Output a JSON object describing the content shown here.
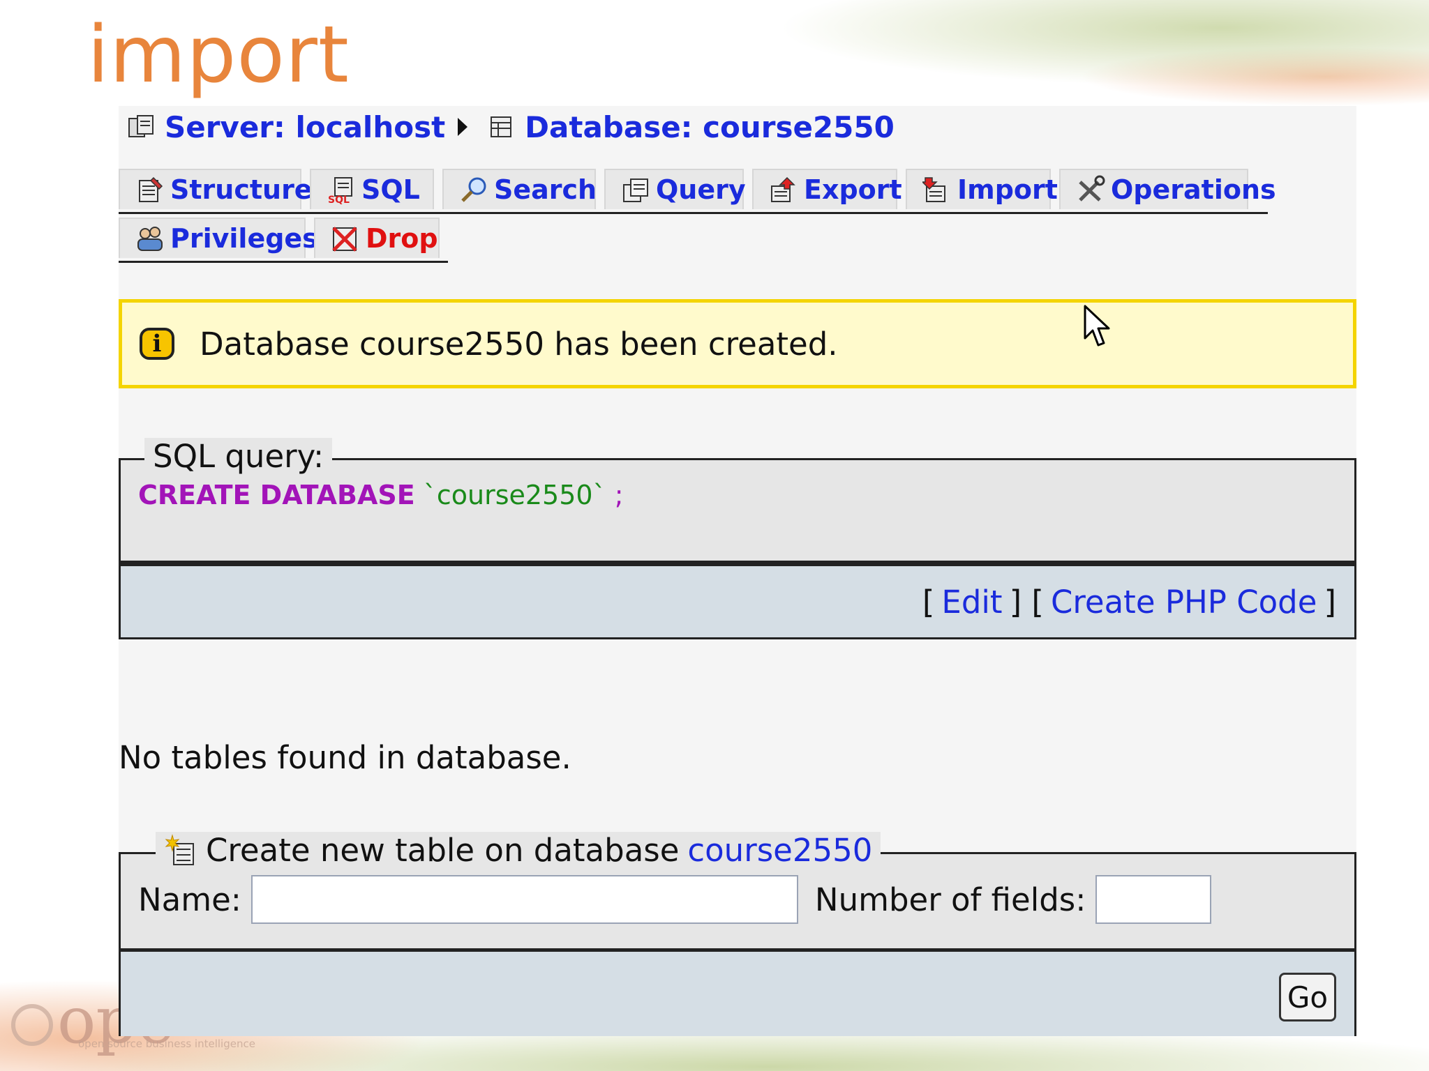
{
  "slide": {
    "title": "import",
    "logo_text": "ope",
    "logo_tagline": "open source business intelligence"
  },
  "breadcrumb": {
    "server": "Server: localhost",
    "database": "Database: course2550"
  },
  "tabs": [
    {
      "label": "Structure",
      "icon": "structure-icon"
    },
    {
      "label": "SQL",
      "icon": "sql-icon"
    },
    {
      "label": "Search",
      "icon": "search-icon"
    },
    {
      "label": "Query",
      "icon": "query-icon"
    },
    {
      "label": "Export",
      "icon": "export-icon"
    },
    {
      "label": "Import",
      "icon": "import-icon"
    },
    {
      "label": "Operations",
      "icon": "operations-icon"
    },
    {
      "label": "Privileges",
      "icon": "privileges-icon"
    },
    {
      "label": "Drop",
      "icon": "drop-icon"
    }
  ],
  "notice": {
    "icon": "info-icon",
    "text": "Database course2550 has been created."
  },
  "sql": {
    "legend": "SQL query:",
    "keyword": "CREATE DATABASE",
    "identifier": "`course2550`",
    "terminator": ";"
  },
  "actions": {
    "edit": "Edit",
    "php": "Create PHP Code"
  },
  "no_tables": "No tables found in database.",
  "create_table": {
    "legend_prefix": "Create new table on database",
    "database": "course2550",
    "name_label": "Name:",
    "name_value": "",
    "fields_label": "Number of fields:",
    "fields_value": "",
    "go": "Go"
  },
  "colors": {
    "link": "#1a2bdc",
    "accent_title": "#e8853c",
    "notice_bg": "#fffacc",
    "notice_border": "#f4d400",
    "sql_keyword": "#a214b8",
    "sql_string": "#1a8a1a",
    "drop": "#e01010"
  }
}
